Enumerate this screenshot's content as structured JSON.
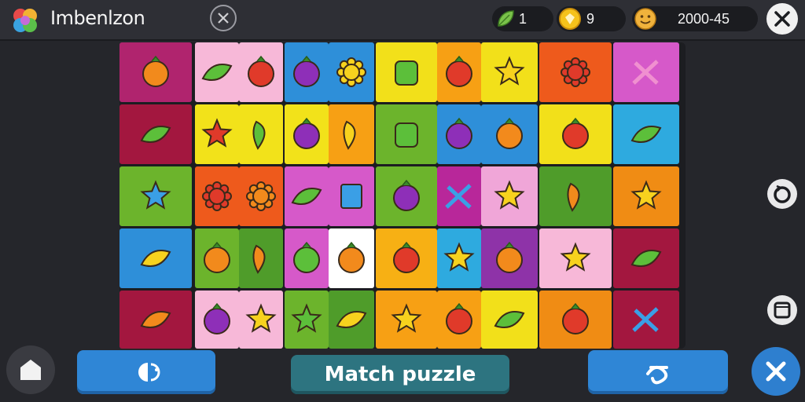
{
  "header": {
    "title": "Imbenlzon",
    "stats": [
      {
        "name": "leaf-count",
        "icon": "leaf-icon",
        "value": "1"
      },
      {
        "name": "coin-count",
        "icon": "coin-icon",
        "value": "9"
      },
      {
        "name": "score",
        "icon": "smiley-icon",
        "value": "2000-45"
      }
    ]
  },
  "board": {
    "rows": 5,
    "columns": 9,
    "tiles": [
      [
        "orange-fruit",
        "green-leafy",
        "red-fruit",
        "purple-berry",
        "yellow-sun",
        "green-jar",
        "red-fruit",
        "yellow-star",
        "red-flower",
        "pink-flag"
      ],
      [
        "green-leaf",
        "red-star",
        "green-pepper",
        "purple-radish",
        "yellow-pepper",
        "green-jar",
        "purple-radish",
        "orange-tomato",
        "red-tomato",
        "green-leaf-flower"
      ],
      [
        "blue-leaf-star",
        "red-gear",
        "orange-sun",
        "green-leafy",
        "blue-robot",
        "purple-berry",
        "blue-hook",
        "yellow-star",
        "orange-carrot",
        "yellow-star"
      ],
      [
        "yellow-leaf",
        "orange-fruit",
        "orange-pepper",
        "green-fruit",
        "orange-cocoon",
        "red-tomato",
        "yellow-star",
        "orange-tomato",
        "yellow-smiley-star",
        "green-leaf"
      ],
      [
        "orange-leaf",
        "purple-berry",
        "yellow-star",
        "green-star",
        "yellow-leaf",
        "yellow-star",
        "red-gem",
        "green-leaf",
        "red-tomato",
        "blue-crossed-arrow"
      ]
    ]
  },
  "footer": {
    "match_label": "Match puzzle"
  },
  "colors": {
    "accent_blue": "#2f86d6",
    "match_teal": "#2d7480",
    "close_blue": "#2e7fcf"
  }
}
